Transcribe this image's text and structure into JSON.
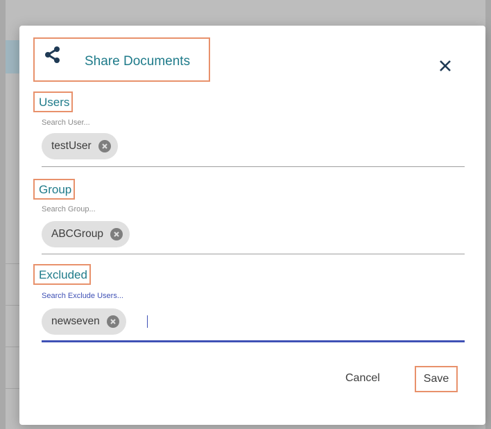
{
  "dialog": {
    "title": "Share Documents",
    "share_icon": "share-icon",
    "close_icon": "close-icon"
  },
  "users": {
    "label": "Users",
    "placeholder": "Search User...",
    "chips": [
      "testUser"
    ]
  },
  "group": {
    "label": "Group",
    "placeholder": "Search Group...",
    "chips": [
      "ABCGroup"
    ]
  },
  "excluded": {
    "label": "Excluded",
    "placeholder": "Search Exclude Users...",
    "chips": [
      "newseven"
    ]
  },
  "actions": {
    "cancel_label": "Cancel",
    "save_label": "Save"
  },
  "colors": {
    "accent": "#1f7b8a",
    "focus": "#3f51b5",
    "highlight": "#e8916b"
  }
}
